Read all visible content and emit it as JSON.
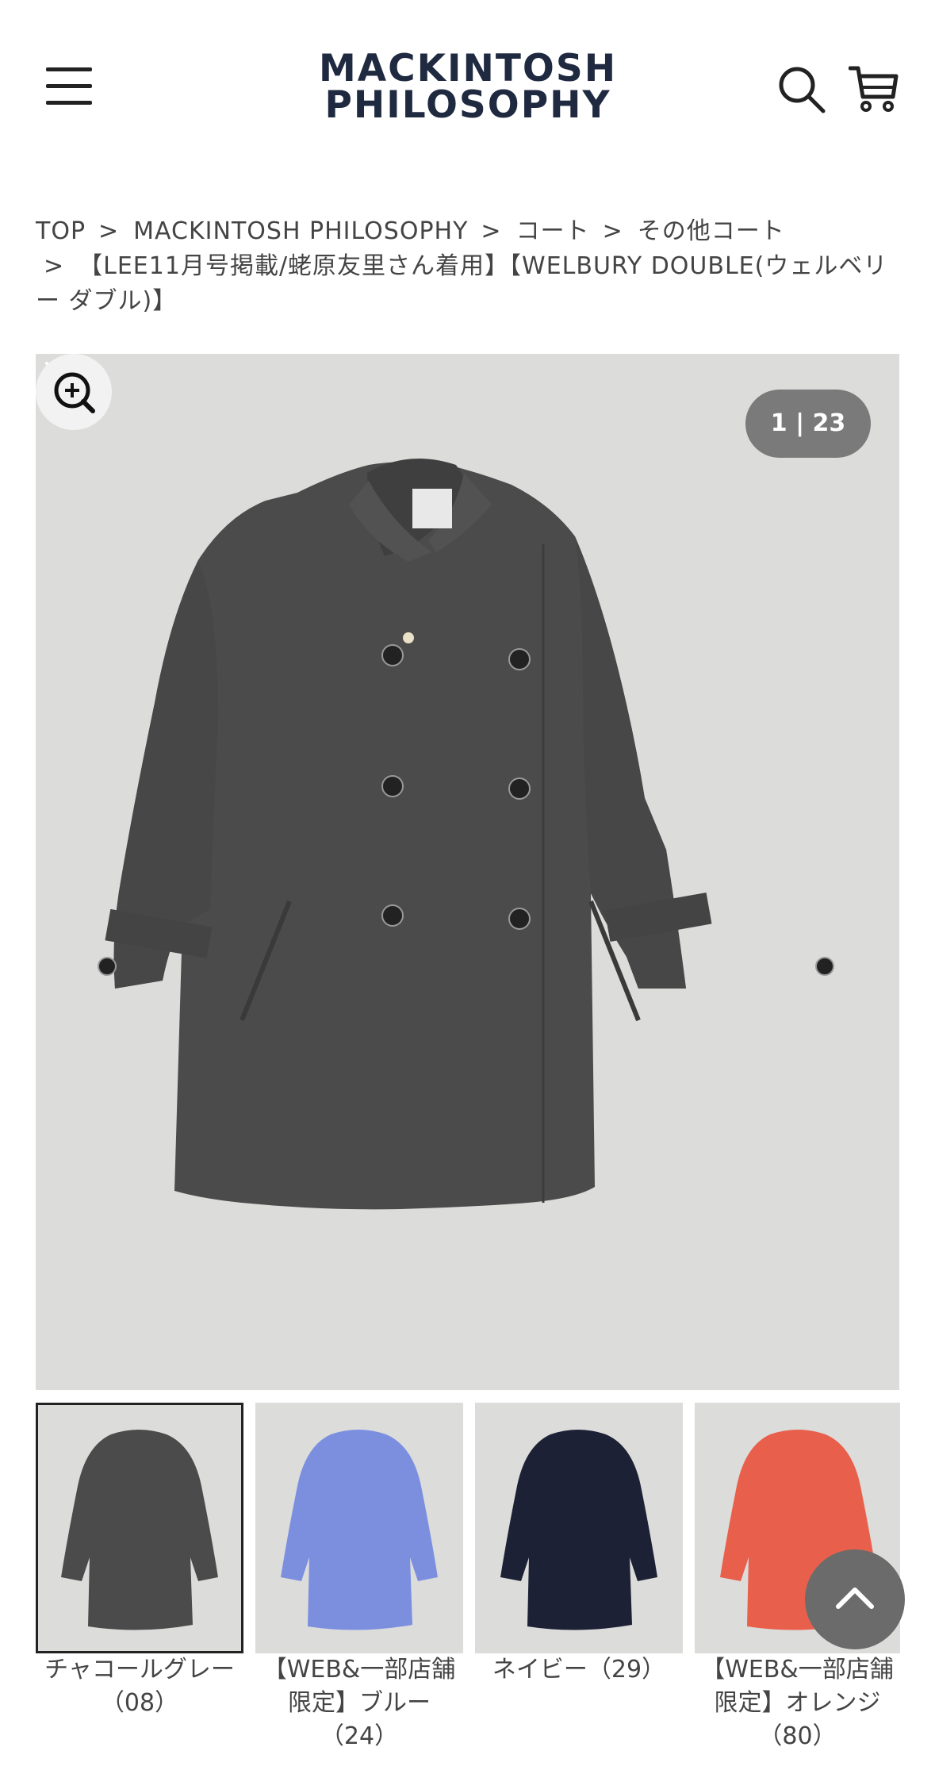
{
  "header": {
    "logo_line1": "MACKINTOSH",
    "logo_line2": "PHILOSOPHY",
    "icons": [
      "menu-icon",
      "search-icon",
      "cart-icon"
    ]
  },
  "breadcrumb": {
    "items": [
      "TOP",
      "MACKINTOSH PHILOSOPHY",
      "コート",
      "その他コート",
      "【LEE11月号掲載/蛯原友里さん着用】【WELBURY DOUBLE(ウェルベリー ダブル)】"
    ],
    "separator": ">"
  },
  "gallery": {
    "counter": "1 | 23",
    "background": "#dcdcdb",
    "icons": [
      "chevron-right-icon",
      "zoom-in-icon"
    ]
  },
  "variants": [
    {
      "label": "チャコールグレー（08）",
      "color": "#4b4b4b",
      "selected": true
    },
    {
      "label": "【WEB&一部店舗限定】ブルー（24）",
      "color": "#7c8fdf",
      "selected": false
    },
    {
      "label": "ネイビー（29）",
      "color": "#1d2135",
      "selected": false
    },
    {
      "label": "【WEB&一部店舗限定】オレンジ（80）",
      "color": "#e8604b",
      "selected": false
    }
  ],
  "scroll_top": {
    "icon": "chevron-up-icon"
  }
}
